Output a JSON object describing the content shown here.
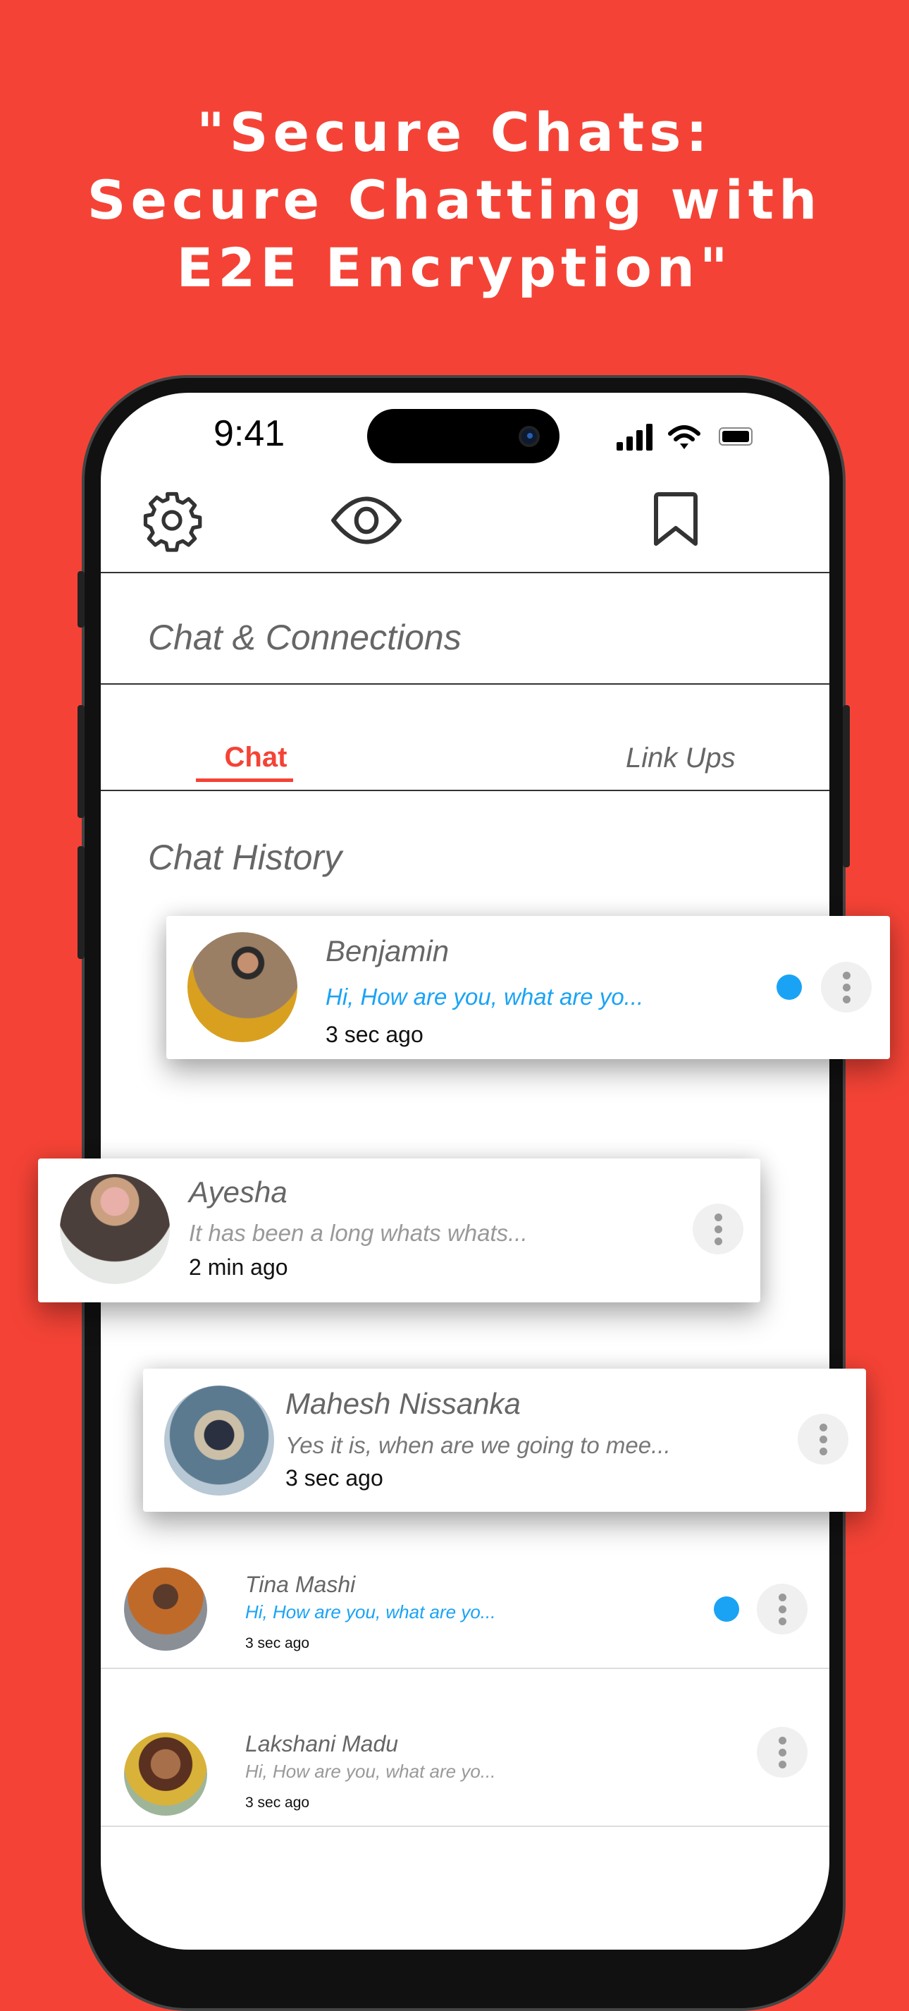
{
  "headline": [
    "\"Secure Chats:",
    "Secure Chatting with",
    "E2E Encryption\""
  ],
  "status_bar": {
    "time": "9:41"
  },
  "toolbar": {
    "icons": [
      "gear-icon",
      "eye-icon",
      "bookmark-icon",
      "chat-bubble-icon"
    ],
    "accent": "#f44336"
  },
  "header": {
    "title": "Chat & Connections"
  },
  "tabs": [
    {
      "label": "Chat",
      "active": true
    },
    {
      "label": "Link Ups",
      "active": false
    }
  ],
  "section_title": "Chat History",
  "colors": {
    "background": "#f44336",
    "unread_dot": "#1aa3f5",
    "unread_text": "#1aa3f5"
  },
  "chats": [
    {
      "name": "Benjamin",
      "message": "Hi, How are you, what are yo...",
      "time": "3 sec ago",
      "unread": true
    },
    {
      "name": "Ayesha",
      "message": "It has been a long whats whats...",
      "time": "2 min ago",
      "unread": false
    },
    {
      "name": "Mahesh Nissanka",
      "message": "Yes it is, when are we going to mee...",
      "time": "3 sec ago",
      "unread": false
    },
    {
      "name": "Tina Mashi",
      "message": "Hi, How are you, what are yo...",
      "time": "3 sec ago",
      "unread": true
    },
    {
      "name": "Lakshani Madu",
      "message": "Hi, How are you, what are yo...",
      "time": "3 sec ago",
      "unread": false
    }
  ]
}
